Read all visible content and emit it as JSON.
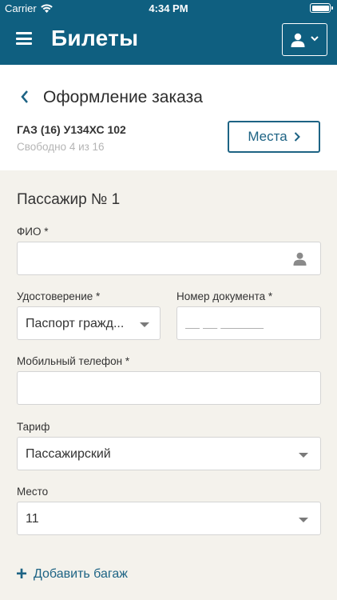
{
  "status_bar": {
    "carrier": "Carrier",
    "time": "4:34 PM",
    "battery_level": 1.0
  },
  "app_bar": {
    "title": "Билеты",
    "menu_icon": "hamburger-icon",
    "user_icon": "user-icon"
  },
  "order": {
    "title": "Оформление заказа",
    "vehicle": "ГАЗ (16) У134ХС 102",
    "free_seats": "Свободно 4 из 16",
    "seats_button": "Места"
  },
  "passenger": {
    "title": "Пассажир № 1",
    "full_name": {
      "label": "ФИО *",
      "value": ""
    },
    "id_doc": {
      "label": "Удостоверение *",
      "value": "Паспорт гражд..."
    },
    "doc_number": {
      "label": "Номер документа *",
      "placeholder": "__ __ ______"
    },
    "phone": {
      "label": "Мобильный телефон *",
      "value": ""
    },
    "tariff": {
      "label": "Тариф",
      "value": "Пассажирский"
    },
    "seat": {
      "label": "Место",
      "value": "11"
    }
  },
  "add_baggage": {
    "label": "Добавить багаж"
  },
  "colors": {
    "primary": "#0f5f80",
    "accent": "#1d6384",
    "background": "#f4f2ec"
  }
}
